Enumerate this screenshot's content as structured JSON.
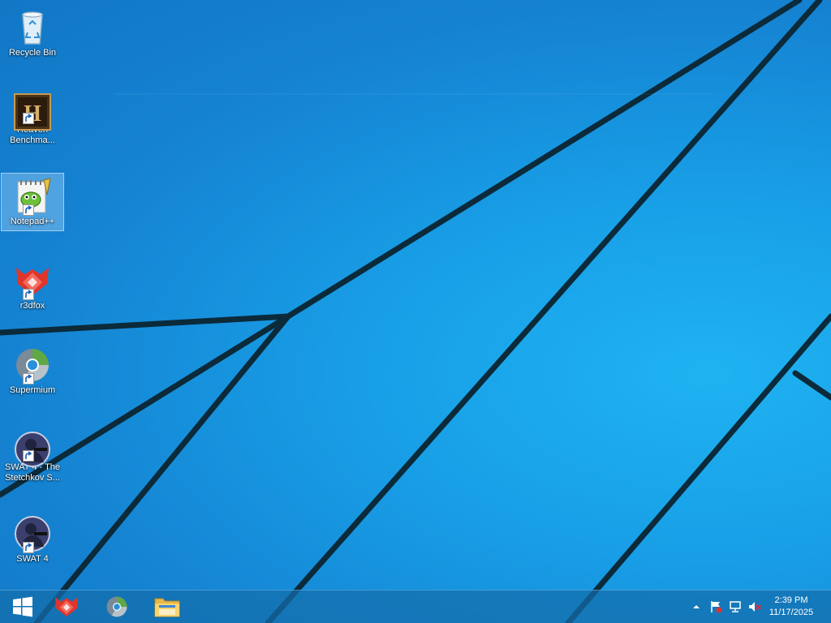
{
  "desktop": {
    "icons": [
      {
        "label": "Recycle Bin",
        "icon": "recycle-bin-icon",
        "shortcut": false,
        "selected": false
      },
      {
        "label": "Heaven\nBenchma...",
        "icon": "heaven-benchmark-icon",
        "shortcut": true,
        "selected": false
      },
      {
        "label": "Notepad++",
        "icon": "notepad-plus-plus-icon",
        "shortcut": true,
        "selected": true
      },
      {
        "label": "r3dfox",
        "icon": "r3dfox-icon",
        "shortcut": true,
        "selected": false
      },
      {
        "label": "Supermium",
        "icon": "supermium-icon",
        "shortcut": true,
        "selected": false
      },
      {
        "label": "SWAT 4 - The\nStetchkov S...",
        "icon": "swat4-icon",
        "shortcut": true,
        "selected": false
      },
      {
        "label": "SWAT 4",
        "icon": "swat4-icon",
        "shortcut": true,
        "selected": false
      }
    ]
  },
  "taskbar": {
    "start_icon": "windows-logo-icon",
    "pinned": [
      "r3dfox-icon",
      "supermium-icon",
      "file-explorer-icon"
    ],
    "tray": {
      "show_hidden": "chevron-up-icon",
      "icons": [
        "action-center-flag-icon",
        "network-icon",
        "volume-muted-icon"
      ]
    },
    "clock": {
      "time": "2:39 PM",
      "date": "11/17/2025"
    }
  },
  "colors": {
    "wallpaper": "#1a8fd8",
    "taskbar": "#146eaa",
    "selection": "#bee1ff"
  }
}
